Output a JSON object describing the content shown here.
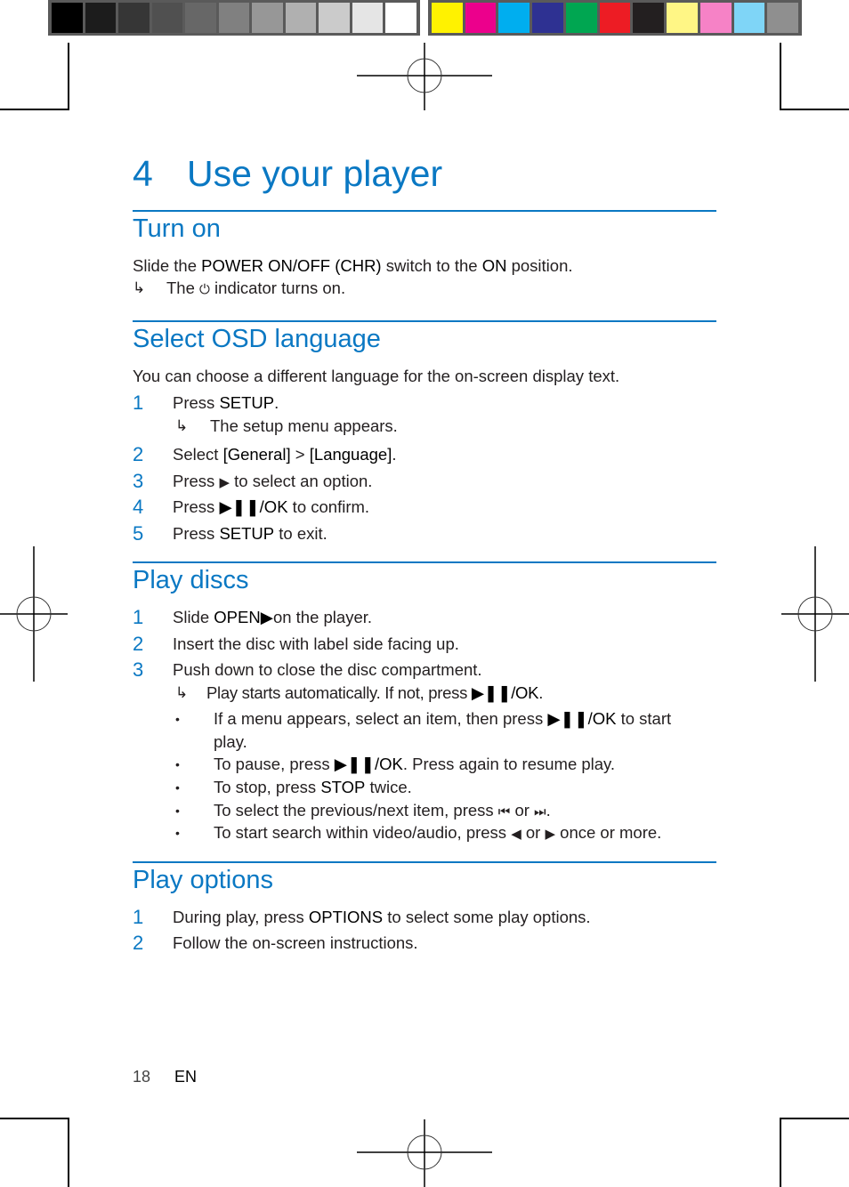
{
  "color_bars": {
    "grayscale": [
      "#000000",
      "#1c1c1c",
      "#363636",
      "#505050",
      "#676767",
      "#808080",
      "#979797",
      "#b0b0b0",
      "#cbcbcb",
      "#e5e5e5",
      "#ffffff"
    ],
    "colors": [
      "#fff200",
      "#ec008c",
      "#00aeef",
      "#2e3192",
      "#00a651",
      "#ed1c24",
      "#231f20",
      "#fff685",
      "#f682c6",
      "#7fd5f7",
      "#8f8f8f"
    ]
  },
  "accent_color": "#0a78c3",
  "chapter": {
    "number": "4",
    "title": "Use your player"
  },
  "sections": {
    "turn_on": {
      "heading": "Turn on",
      "text_1": "Slide the ",
      "bold_1": "POWER ON/OFF (CHR)",
      "text_2": " switch to the ",
      "bold_2": "ON",
      "text_3": " position.",
      "result_pre": "The ",
      "result_icon": "⏻",
      "result_post": " indicator turns on."
    },
    "osd": {
      "heading": "Select OSD language",
      "intro": "You can choose a different language for the on-screen display text.",
      "steps": [
        {
          "n": "1",
          "pre": "Press ",
          "bold": "SETUP",
          "post": ".",
          "result": "The setup menu appears."
        },
        {
          "n": "2",
          "pre": "Select ",
          "bold": "[General]",
          "mid": " > ",
          "bold2": "[Language]",
          "post": "."
        },
        {
          "n": "3",
          "pre": "Press ",
          "sym": "▶",
          "post": " to select an option."
        },
        {
          "n": "4",
          "pre": "Press ",
          "bold": "▶❚❚/OK",
          "post": " to confirm."
        },
        {
          "n": "5",
          "pre": "Press ",
          "bold": "SETUP",
          "post": " to exit."
        }
      ]
    },
    "play_discs": {
      "heading": "Play discs",
      "steps": [
        {
          "n": "1",
          "pre": "Slide ",
          "bold": "OPEN▶",
          "post": "on the player."
        },
        {
          "n": "2",
          "text": "Insert the disc with label side facing up."
        },
        {
          "n": "3",
          "text": "Push down to close the disc compartment.",
          "result_pre": "Play starts automatically. If not, press ",
          "result_bold": "▶❚❚/OK",
          "result_post": "."
        }
      ],
      "bullets": [
        {
          "pre": "If a menu appears, select an item, then press ",
          "bold": "▶❚❚/OK",
          "post": " to start",
          "line2": "play."
        },
        {
          "pre": "To pause, press ",
          "bold": "▶❚❚/OK",
          "post": ". Press again to resume play."
        },
        {
          "pre": "To stop, press ",
          "bold": "STOP",
          "post": " twice."
        },
        {
          "pre": "To select the previous/next item, press ",
          "sym1": "⏮",
          "mid": " or ",
          "sym2": "⏭",
          "post": "."
        },
        {
          "pre": "To start search within video/audio, press ",
          "sym1": "◀",
          "mid": " or ",
          "sym2": "▶",
          "post": " once or more."
        }
      ]
    },
    "play_options": {
      "heading": "Play options",
      "steps": [
        {
          "n": "1",
          "pre": "During play, press ",
          "bold": "OPTIONS",
          "post": " to select some play options."
        },
        {
          "n": "2",
          "text": "Follow the on-screen instructions."
        }
      ]
    }
  },
  "footer": {
    "page_number": "18",
    "language": "EN"
  },
  "symbols": {
    "result_arrow": "↳",
    "bullet": "•"
  }
}
